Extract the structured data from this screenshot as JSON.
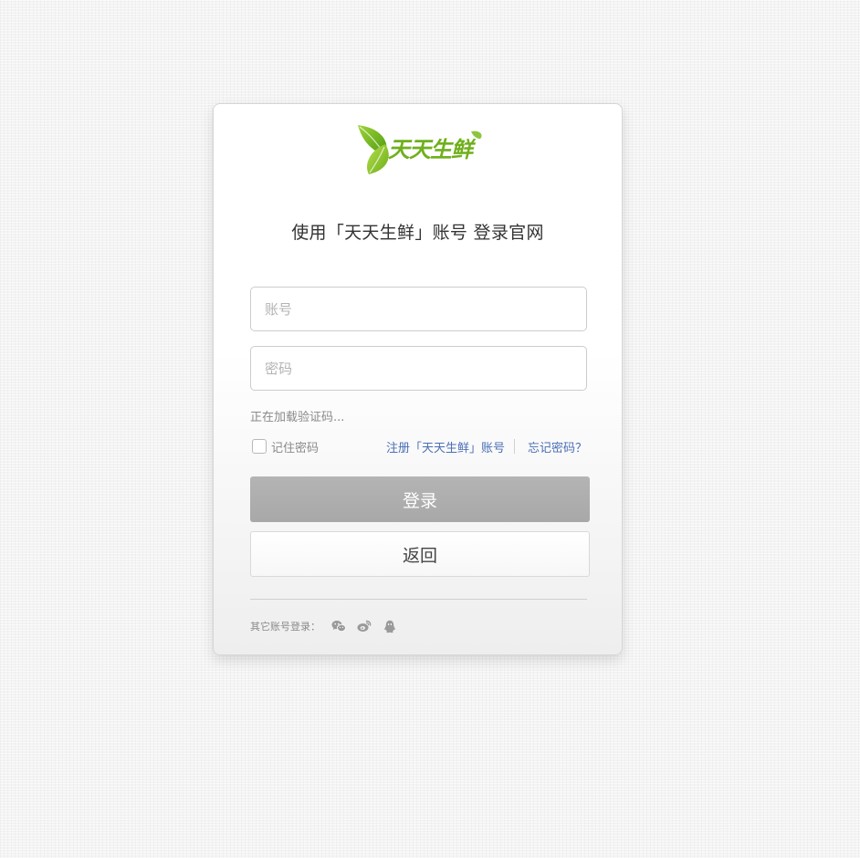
{
  "logo": {
    "text": "天天生鲜",
    "brand_color": "#6fb01c"
  },
  "login": {
    "title": "使用「天天生鲜」账号 登录官网",
    "account_placeholder": "账号",
    "password_placeholder": "密码",
    "captcha_status": "正在加载验证码...",
    "remember_label": "记住密码",
    "register_link": "注册「天天生鲜」账号",
    "forgot_link": "忘记密码？",
    "login_button": "登录",
    "back_button": "返回",
    "other_login_label": "其它账号登录：",
    "social_icons": [
      "wechat-icon",
      "weibo-icon",
      "qq-icon"
    ],
    "link_color": "#4a6fb6"
  }
}
